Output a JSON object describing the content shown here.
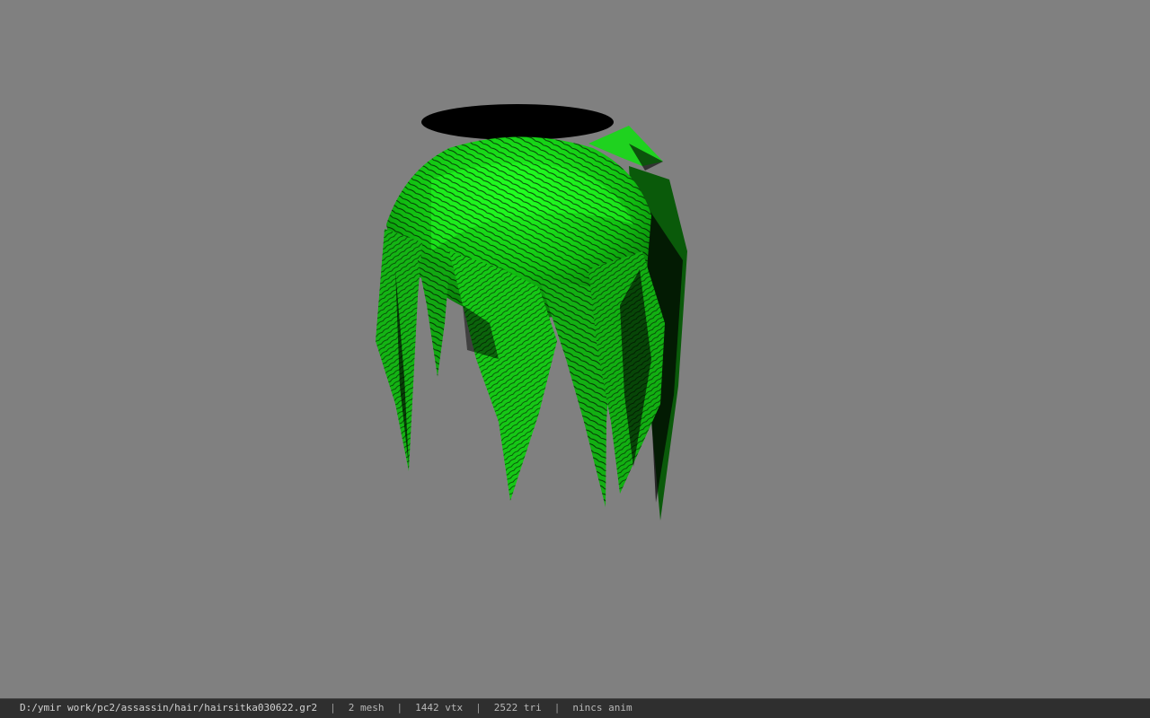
{
  "viewer": {
    "background_color": "#808080",
    "model_color": "#14cc14"
  },
  "status": {
    "file_path": "D:/ymir work/pc2/assassin/hair/hairsitka030622.gr2",
    "separator": "|",
    "mesh_count": "2 mesh",
    "vertex_count": "1442 vtx",
    "triangle_count": "2522 tri",
    "anim_status": "nincs anim"
  }
}
